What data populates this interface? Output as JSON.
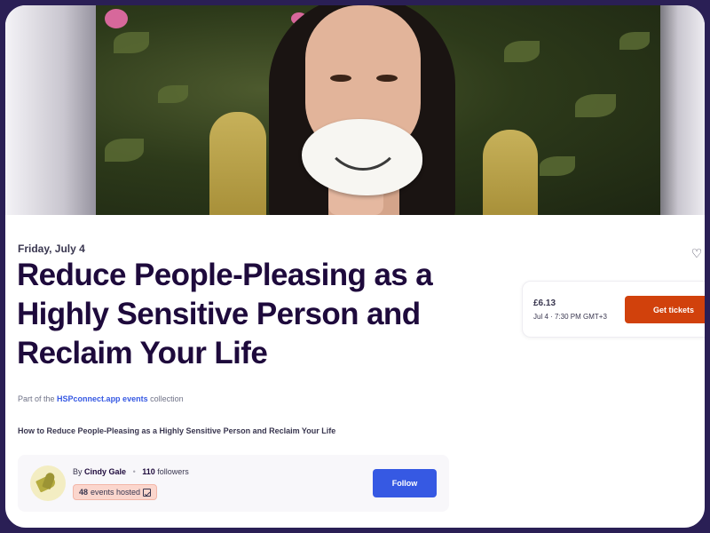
{
  "event": {
    "date_label": "Friday, July 4",
    "title": "Reduce People-Pleasing as a Highly Sensitive Person and Reclaim Your Life",
    "collection_prefix": "Part of the",
    "collection_name": "HSPconnect.app events",
    "collection_suffix": "collection",
    "summary": "How to Reduce People-Pleasing as a Highly Sensitive Person and Reclaim Your Life",
    "hero_icon": "event-banner-photo"
  },
  "ticket": {
    "price": "£6.13",
    "date_time": "Jul 4 · 7:30 PM GMT+3",
    "button_label": "Get tickets",
    "button_color": "#d1410c"
  },
  "organizer": {
    "by_label": "By",
    "name": "Cindy Gale",
    "followers_count": "110",
    "followers_label": "followers",
    "events_count": "48",
    "events_label": "events hosted",
    "follow_label": "Follow",
    "follow_color": "#3659e3"
  },
  "icons": {
    "like": "heart-icon",
    "events_badge": "checkbox-icon"
  }
}
